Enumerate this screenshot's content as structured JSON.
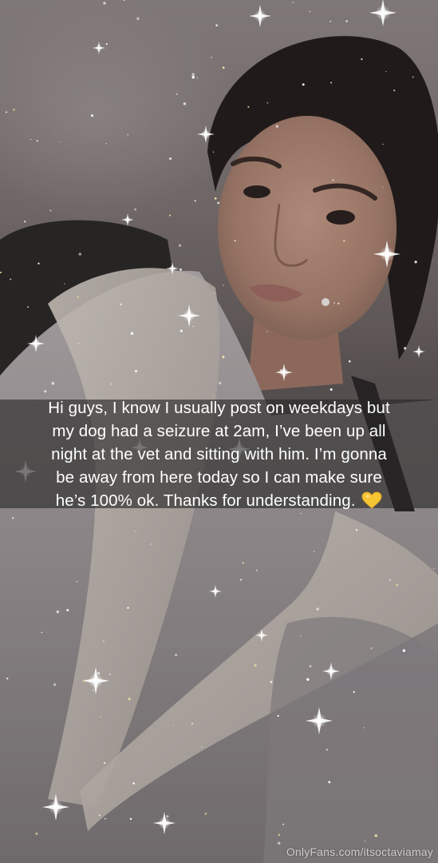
{
  "caption": {
    "lines": [
      "Hi guys, I know I usually post on weekdays but",
      "my dog had a seizure at 2am, I’ve been up all",
      "night at the vet and sitting with him. I’m gonna",
      "be away from here today so I can make sure",
      "he’s 100% ok. Thanks for understanding."
    ],
    "emoji": "yellow-heart-icon"
  },
  "watermark": "OnlyFans.com/itsoctaviamay",
  "colors": {
    "caption_bg": "#282626",
    "heart": "#F6C334",
    "sparkle": "#FFFFFF"
  }
}
